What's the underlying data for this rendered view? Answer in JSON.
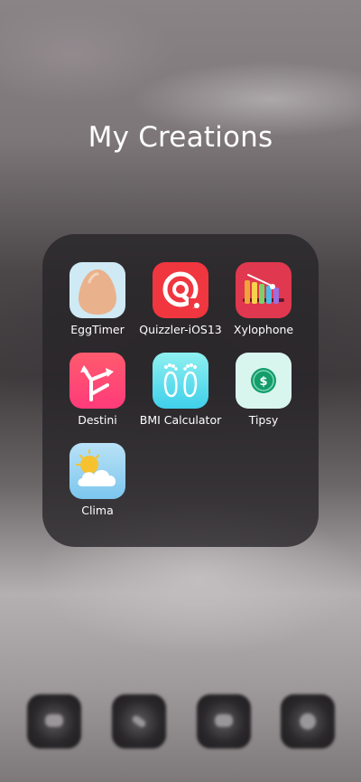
{
  "folder": {
    "title": "My Creations",
    "apps": [
      {
        "label": "EggTimer",
        "icon": "egg-icon"
      },
      {
        "label": "Quizzler-iOS13",
        "icon": "quiz-q-icon"
      },
      {
        "label": "Xylophone",
        "icon": "xylophone-icon"
      },
      {
        "label": "Destini",
        "icon": "split-arrows-icon"
      },
      {
        "label": "BMI Calculator",
        "icon": "footprints-icon"
      },
      {
        "label": "Tipsy",
        "icon": "dollar-coin-icon"
      },
      {
        "label": "Clima",
        "icon": "sun-cloud-icon"
      }
    ]
  },
  "colors": {
    "egg_bg": "#cfeaf5",
    "egg": "#e9b28c",
    "quiz_bg": "#f0363f",
    "xylo_bg": "#e0384f",
    "destini_top": "#ff5b6e",
    "destini_bottom": "#ff3b7a",
    "bmi_top": "#8ff0f0",
    "bmi_bottom": "#3fd0ea",
    "tipsy_bg": "#d9f6ee",
    "tipsy_coin": "#139d6b",
    "clima_top": "#b9e2f6",
    "clima_bottom": "#7cc6ee"
  },
  "dock": {
    "icons": [
      "dock-app-1-icon",
      "dock-app-2-icon",
      "dock-app-3-icon",
      "dock-app-4-icon"
    ]
  }
}
